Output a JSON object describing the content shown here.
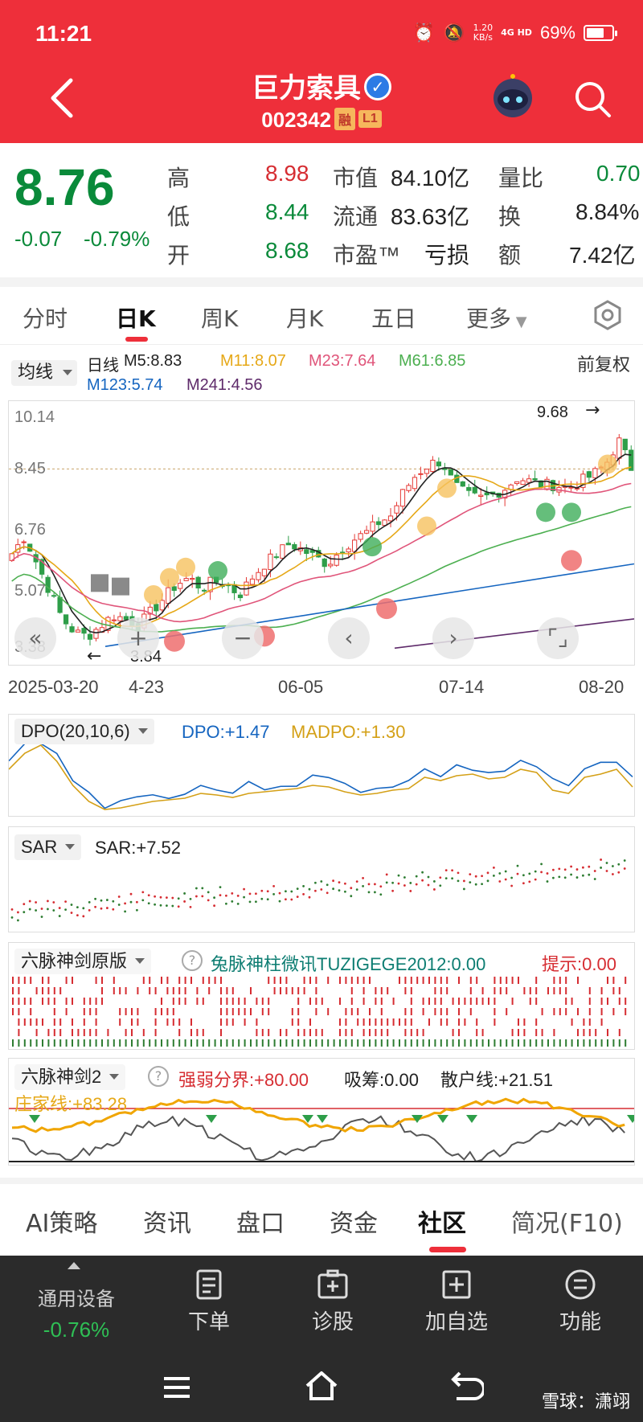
{
  "status": {
    "time": "11:21",
    "speed_value": "1.20",
    "speed_unit": "KB/s",
    "network": "4G HD",
    "battery": "69%",
    "battery_level": 0.69
  },
  "header": {
    "title": "巨力索具",
    "code": "002342",
    "tag1": "融",
    "tag2": "L1"
  },
  "quote": {
    "price": "8.76",
    "change": "-0.07",
    "change_pct": "-0.79%",
    "high_label": "高",
    "high": "8.98",
    "low_label": "低",
    "low": "8.44",
    "open_label": "开",
    "open": "8.68",
    "mcap_label": "市值",
    "mcap": "84.10亿",
    "float_label": "流通",
    "float": "83.63亿",
    "pe_label": "市盈™",
    "pe": "亏损",
    "vr_label": "量比",
    "vr": "0.70",
    "turn_label": "换",
    "turn": "8.84%",
    "amt_label": "额",
    "amt": "7.42亿"
  },
  "tabs": [
    "分时",
    "日K",
    "周K",
    "月K",
    "五日",
    "更多"
  ],
  "legend": {
    "dropdown": "均线",
    "kind": "日线",
    "m5": "M5:8.83",
    "m11": "M11:8.07",
    "m23": "M23:7.64",
    "m61": "M61:6.85",
    "m123": "M123:5.74",
    "m241": "M241:4.56",
    "adjust": "前复权"
  },
  "main_chart": {
    "y_labels": [
      "10.14",
      "8.45",
      "6.76",
      "5.07",
      "3.38"
    ],
    "x_labels": [
      "2025-03-20",
      "4-23",
      "06-05",
      "07-14",
      "08-20"
    ],
    "max_label": "9.68",
    "min_label": "3.84",
    "colors": {
      "m5": "#222222",
      "m11": "#e6a817",
      "m23": "#e0557a",
      "m61": "#4caf50",
      "m123": "#1565c0",
      "m241": "#5e2a6a",
      "up": "#e53935",
      "down": "#2e9e49"
    }
  },
  "dpo": {
    "name": "DPO(20,10,6)",
    "dpo": "DPO:+1.47",
    "madpo": "MADPO:+1.30"
  },
  "sar": {
    "name": "SAR",
    "value": "SAR:+7.52"
  },
  "six1": {
    "name": "六脉神剑原版",
    "text": "兔脉神柱微讯TUZIGEGE2012:0.00",
    "tip": "提示:0.00"
  },
  "six2": {
    "name": "六脉神剑2",
    "a": "强弱分界:+80.00",
    "b": "吸筹:0.00",
    "c": "散户线:+21.51",
    "d": "庄家线:+83.28"
  },
  "bottom_tabs": [
    "AI策略",
    "资讯",
    "盘口",
    "资金",
    "社区",
    "简况(F10)"
  ],
  "dock": {
    "sector": "通用设备",
    "sector_chg": "-0.76%",
    "order": "下单",
    "diagnose": "诊股",
    "add": "加自选",
    "func": "功能"
  },
  "watermark": "雪球：潇翊"
}
